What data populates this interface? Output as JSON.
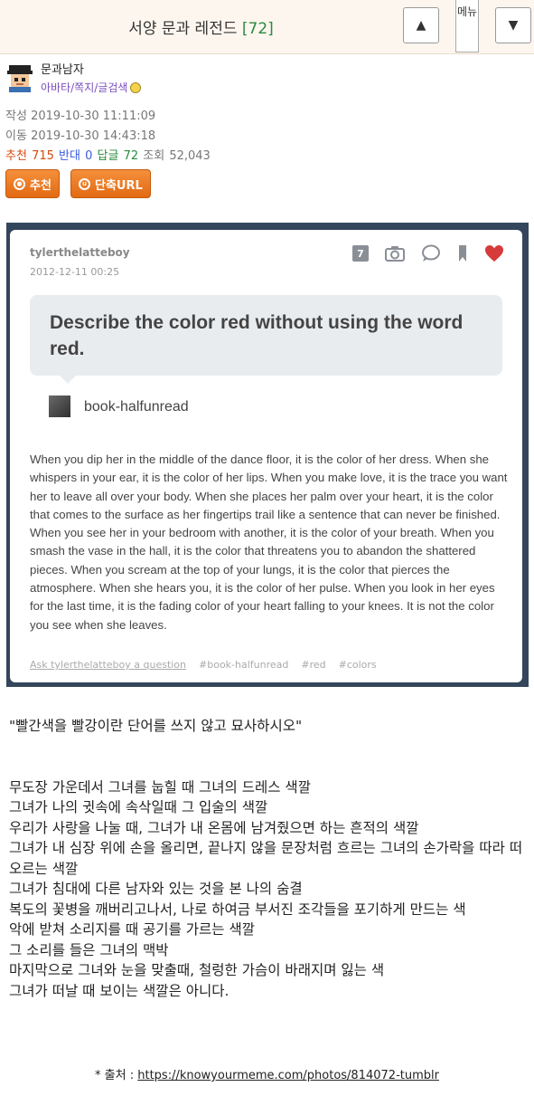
{
  "header": {
    "title": "서양 문과 레전드",
    "count": "[72]",
    "menu_label": "메뉴",
    "up_glyph": "▲",
    "down_glyph": "▼"
  },
  "author": {
    "name": "문과남자",
    "links": "아바타/쪽지/글검색"
  },
  "meta": {
    "written_label": "작성",
    "written": "2019-10-30 11:11:09",
    "moved_label": "이동",
    "moved": "2019-10-30 14:43:18",
    "recommend_label": "추천",
    "recommend": "715",
    "oppose_label": "반대",
    "oppose": "0",
    "replies_label": "답글",
    "replies": "72",
    "views_label": "조회",
    "views": "52,043"
  },
  "buttons": {
    "recommend": "추천",
    "short_url": "단축URL"
  },
  "tumblr": {
    "username": "tylerthelatteboy",
    "date": "2012-12-11 00:25",
    "note_count": "7",
    "question": "Describe the color red without using the word red.",
    "asker": "book-halfunread",
    "answer": "When you dip her in the middle of the dance floor, it is the color of her dress. When she whispers in your ear, it is the color of her lips. When you make love, it is the trace you want her to leave all over your body. When she places her palm over your heart, it is the color that comes to the surface as her fingertips trail like a sentence that can never be finished. When you see her in your bedroom with another, it is the color of your breath. When you smash the vase in the hall, it is the color that threatens you to abandon the shattered pieces. When you scream at the top of your lungs, it is the color that pierces the atmosphere. When she hears you, it is the color of her pulse. When you look in her eyes for the last time, it is the fading color of your heart falling to your knees. It is not the color you see when she leaves.",
    "ask_link": "Ask tylerthelatteboy a question",
    "tags": [
      "#book-halfunread",
      "#red",
      "#colors"
    ]
  },
  "body": {
    "headline": "\"빨간색을 빨강이란 단어를 쓰지 않고 묘사하시오\"",
    "lines": [
      "무도장 가운데서 그녀를 눕힐 때 그녀의 드레스 색깔",
      "그녀가 나의 귓속에 속삭일때 그 입술의 색깔",
      "우리가 사랑을 나눌 때, 그녀가 내 온몸에 남겨줬으면 하는 흔적의 색깔",
      "그녀가 내 심장 위에 손을 올리면, 끝나지 않을 문장처럼 흐르는 그녀의 손가락을 따라 떠오르는 색깔",
      "그녀가 침대에 다른 남자와 있는 것을 본 나의 숨결",
      "복도의 꽃병을 깨버리고나서, 나로 하여금 부서진 조각들을 포기하게 만드는 색",
      "악에 받쳐 소리지를 때 공기를 가르는 색깔",
      "그 소리를 들은 그녀의 맥박",
      "마지막으로 그녀와 눈을 맞출때, 철렁한 가슴이 바래지며 잃는 색",
      "그녀가 떠날 때 보이는 색깔은 아니다."
    ]
  },
  "source": {
    "label": "* 출처 : ",
    "url": "https://knowyourmeme.com/photos/814072-tumblr"
  },
  "colors": {
    "accent_orange": "#e26a12",
    "heart_red": "#d63a3a",
    "tumblr_navy": "#34465c",
    "recommend_red": "#d9480f",
    "oppose_blue": "#3b5bdb",
    "reply_green": "#2b8a3e"
  }
}
